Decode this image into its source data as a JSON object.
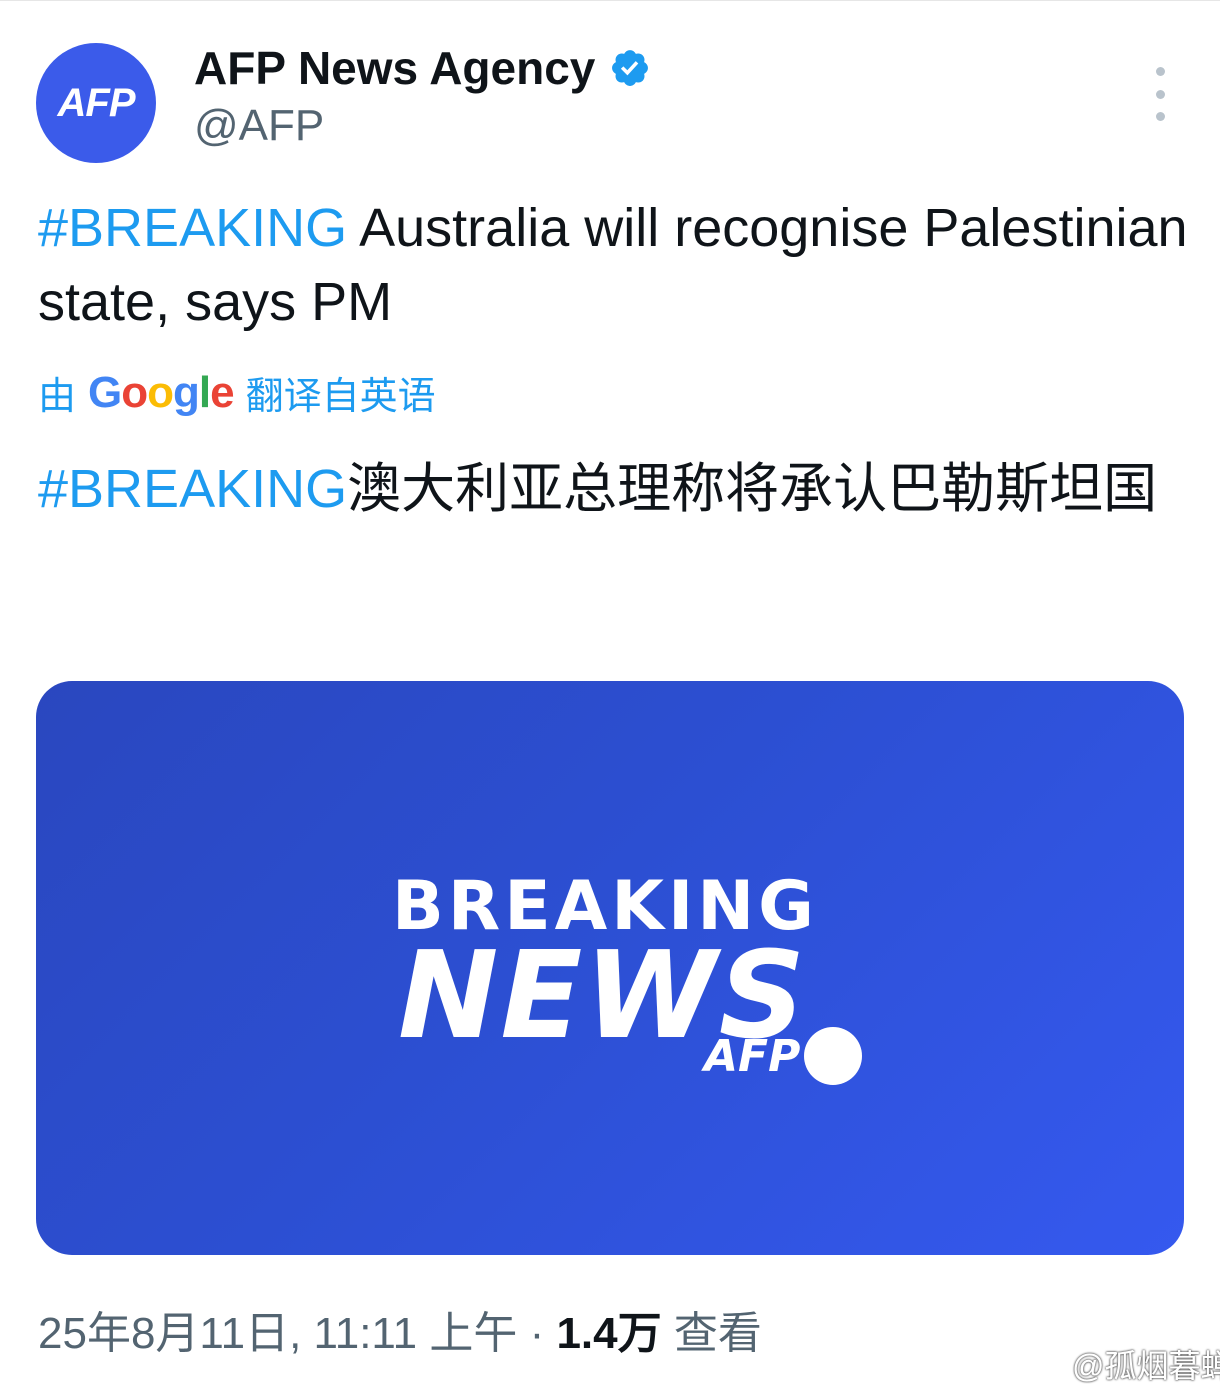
{
  "colors": {
    "accent": "#1d9bf0",
    "brand_avatar": "#3b5bea",
    "media_bg_start": "#2a47bf",
    "media_bg_end": "#3559ef",
    "text_primary": "#0f1419",
    "text_secondary": "#536471"
  },
  "author": {
    "avatar_text": "AFP",
    "display_name": "AFP News Agency",
    "verified_icon": "verified-badge-icon",
    "handle": "@AFP"
  },
  "more_icon": "more-options-icon",
  "tweet": {
    "hashtag": "#BREAKING",
    "text": " Australia will recognise Palestinian state, says PM"
  },
  "translation": {
    "prefix": "由",
    "provider": "Google",
    "suffix": "翻译自英语",
    "hashtag": "#BREAKING",
    "text": "澳大利亚总理称将承认巴勒斯坦国"
  },
  "media": {
    "line1": "BREAKING",
    "line2": "NEWS",
    "logo_text": "AFP"
  },
  "meta": {
    "timestamp": "25年8月11日, 11:11 上午",
    "separator": " · ",
    "views_count": "1.4万",
    "views_label": " 查看"
  },
  "watermark": {
    "icon": "weibo-icon",
    "text": "@孤烟暮蝉"
  }
}
